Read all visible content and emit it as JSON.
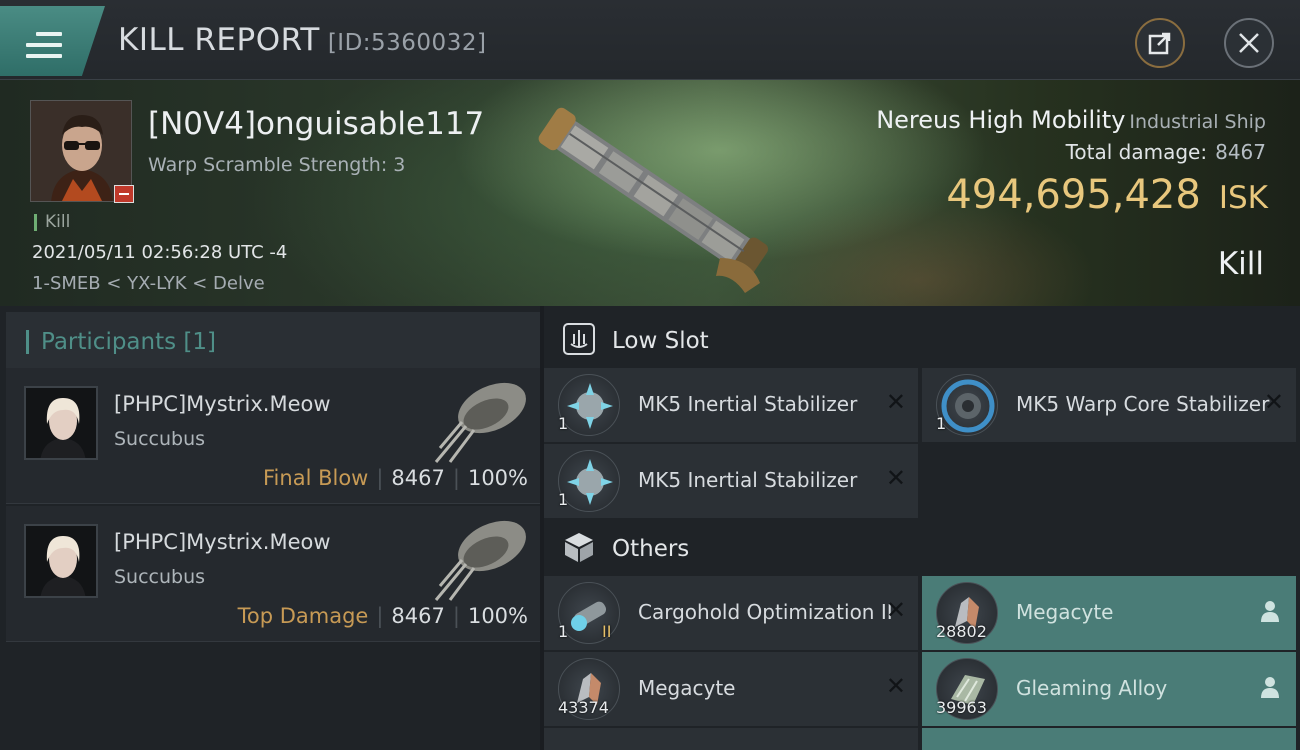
{
  "header": {
    "title": "KILL REPORT",
    "id": "[ID:5360032]",
    "icons": {
      "menu": "hamburger-menu-icon",
      "share": "share-icon",
      "close": "close-icon"
    }
  },
  "victim": {
    "name": "[N0V4]onguisable117",
    "warp_scramble": "Warp Scramble Strength: 3",
    "tag": "Kill",
    "timestamp": "2021/05/11 02:56:28 UTC -4",
    "location": "1-SMEB < YX-LYK < Delve",
    "ship_name": "Nereus High Mobility",
    "ship_class": "Industrial Ship",
    "damage_label": "Total damage:",
    "damage_value": "8467",
    "isk_value": "494,695,428",
    "isk_unit": "ISK",
    "result": "Kill"
  },
  "participants": {
    "header": "Participants [1]",
    "rows": [
      {
        "name": "[PHPC]Mystrix.Meow",
        "ship": "Succubus",
        "tag": "Final Blow",
        "damage": "8467",
        "percent": "100%"
      },
      {
        "name": "[PHPC]Mystrix.Meow",
        "ship": "Succubus",
        "tag": "Top Damage",
        "damage": "8467",
        "percent": "100%"
      }
    ]
  },
  "low_slot": {
    "label": "Low Slot",
    "items": [
      {
        "name": "MK5 Inertial Stabilizer",
        "qty": "1",
        "state": "destroyed"
      },
      {
        "name": "MK5 Warp Core Stabilizer",
        "qty": "1",
        "state": "destroyed"
      },
      {
        "name": "MK5 Inertial Stabilizer",
        "qty": "1",
        "state": "destroyed"
      }
    ]
  },
  "others": {
    "label": "Others",
    "items": [
      {
        "name": "Cargohold Optimization II",
        "qty": "1",
        "state": "destroyed",
        "tech": "II"
      },
      {
        "name": "Megacyte",
        "qty": "28802",
        "state": "dropped"
      },
      {
        "name": "Megacyte",
        "qty": "43374",
        "state": "destroyed"
      },
      {
        "name": "Gleaming Alloy",
        "qty": "39963",
        "state": "dropped"
      }
    ]
  },
  "colors": {
    "accent_teal": "#4f8f88",
    "isk_gold": "#e8c77d",
    "dropped_bg": "#4a7c77",
    "tag_gold": "#c79a55"
  }
}
